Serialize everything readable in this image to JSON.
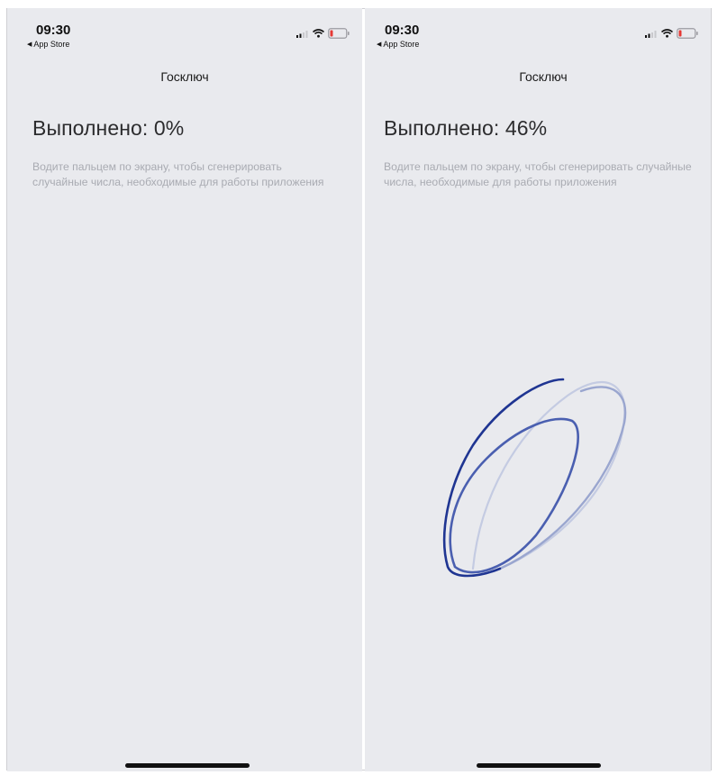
{
  "screens": [
    {
      "status": {
        "time": "09:30",
        "back_label": "App Store"
      },
      "nav": {
        "title": "Госключ"
      },
      "progress": {
        "heading": "Выполнено: 0%",
        "percent": 0
      },
      "hint": "Водите пальцем по экрану, чтобы сгенерировать случайные числа, необходимые для работы приложения"
    },
    {
      "status": {
        "time": "09:30",
        "back_label": "App Store"
      },
      "nav": {
        "title": "Госключ"
      },
      "progress": {
        "heading": "Выполнено: 46%",
        "percent": 46
      },
      "hint": "Водите пальцем по экрану, чтобы сгенерировать случайные числа, необходимые для работы приложения"
    }
  ],
  "icons": {
    "signal": "signal-icon",
    "wifi": "wifi-icon",
    "battery": "battery-icon",
    "back": "back-arrow-icon"
  },
  "colors": {
    "background": "#e9eaee",
    "trace_dark": "#1f3592",
    "trace_mid": "#4a5fb0",
    "trace_light": "#9aa6cf",
    "trace_faint": "#c4cbe2",
    "battery_low": "#e53935"
  }
}
